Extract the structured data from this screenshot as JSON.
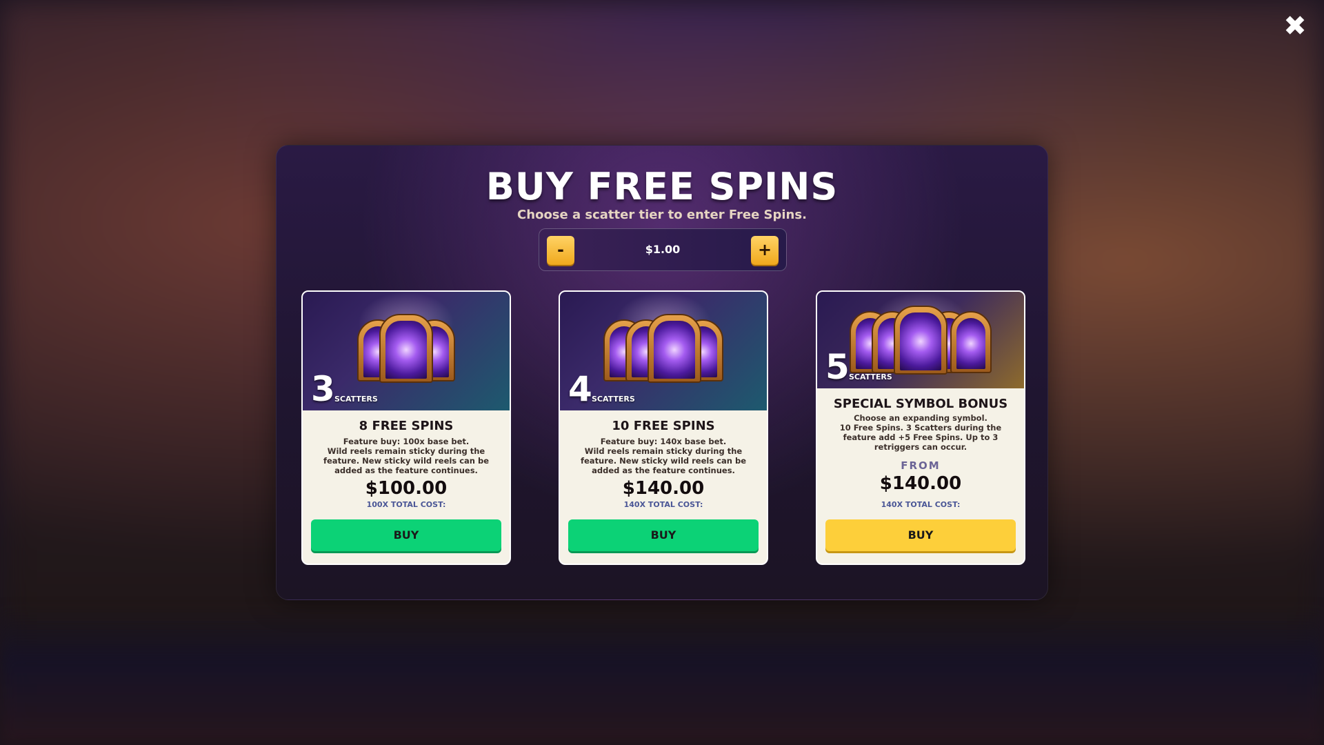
{
  "close_label": "✖",
  "modal": {
    "title": "BUY FREE SPINS",
    "subtitle": "Choose a scatter tier to enter Free Spins.",
    "bet": {
      "minus": "-",
      "value": "$1.00",
      "plus": "+"
    }
  },
  "cards": [
    {
      "scatter_count": "3",
      "scatter_label": "SCATTERS",
      "name": "8 FREE SPINS",
      "desc_lines": [
        "Feature buy: 100x base bet.",
        "Wild reels remain sticky during the feature. New sticky wild reels can be added as the feature continues."
      ],
      "price": "$100.00",
      "total_cost": "100X TOTAL COST:",
      "buy": "BUY",
      "button_color": "#0cd276"
    },
    {
      "scatter_count": "4",
      "scatter_label": "SCATTERS",
      "name": "10 FREE SPINS",
      "desc_lines": [
        "Feature buy: 140x base bet.",
        "Wild reels remain sticky during the feature. New sticky wild reels can be added as the feature continues."
      ],
      "price": "$140.00",
      "total_cost": "140X TOTAL COST:",
      "buy": "BUY",
      "button_color": "#0cd276"
    },
    {
      "scatter_count": "5",
      "scatter_label": "SCATTERS",
      "name": "SPECIAL SYMBOL BONUS",
      "desc_lines": [
        "Choose an expanding symbol.",
        "10 Free Spins. 3 Scatters during the feature add +5 Free Spins. Up to 3 retriggers can occur."
      ],
      "from": "FROM",
      "price": "$140.00",
      "total_cost": "140X TOTAL COST:",
      "buy": "BUY",
      "button_color": "#fdcf3a"
    }
  ],
  "icons": {
    "close": "close-icon",
    "portal": "portal-icon"
  }
}
